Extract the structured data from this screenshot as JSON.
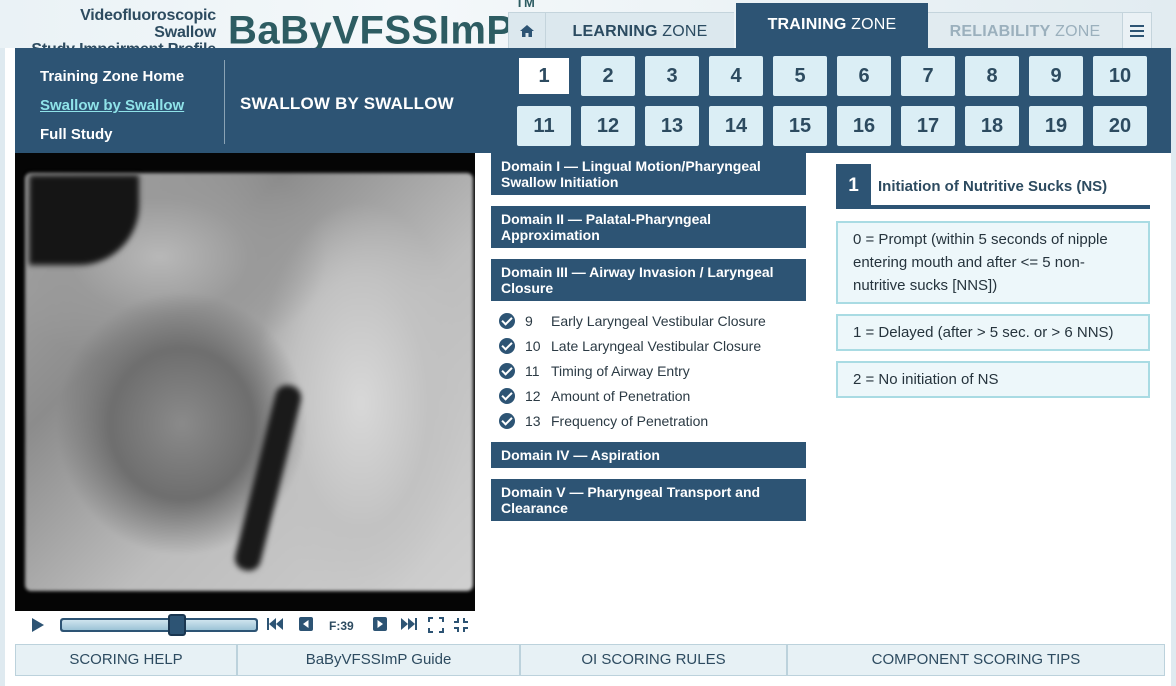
{
  "header": {
    "subtitle_line1": "Videofluoroscopic Swallow",
    "subtitle_line2": "Study Impairment Profile",
    "logo": "BaByVFSSImP",
    "logo_tm": "TM"
  },
  "zones": {
    "learning_bold": "LEARNING",
    "learning_rest": " ZONE",
    "training_bold": "TRAINING",
    "training_rest": " ZONE",
    "reliability_bold": "RELIABILITY",
    "reliability_rest": " ZONE"
  },
  "nav": {
    "links": [
      "Training Zone Home",
      "Swallow by Swallow",
      "Full Study"
    ],
    "active_index": 1,
    "section_title": "SWALLOW BY SWALLOW"
  },
  "swallows": {
    "numbers": [
      "1",
      "2",
      "3",
      "4",
      "5",
      "6",
      "7",
      "8",
      "9",
      "10",
      "11",
      "12",
      "13",
      "14",
      "15",
      "16",
      "17",
      "18",
      "19",
      "20"
    ],
    "active": "1"
  },
  "player": {
    "frame_label": "F:39",
    "progress": 0.6
  },
  "domains": [
    {
      "title": "Domain I — Lingual Motion/Pharyngeal Swallow Initiation",
      "items": []
    },
    {
      "title": "Domain II — Palatal-Pharyngeal Approximation",
      "items": []
    },
    {
      "title": "Domain III — Airway Invasion / Laryngeal Closure",
      "items": [
        {
          "num": "9",
          "label": "Early Laryngeal Vestibular Closure"
        },
        {
          "num": "10",
          "label": "Late Laryngeal Vestibular Closure"
        },
        {
          "num": "11",
          "label": "Timing of Airway Entry"
        },
        {
          "num": "12",
          "label": "Amount of Penetration"
        },
        {
          "num": "13",
          "label": "Frequency of Penetration"
        }
      ]
    },
    {
      "title": "Domain IV — Aspiration",
      "items": []
    },
    {
      "title": "Domain V — Pharyngeal Transport and Clearance",
      "items": []
    }
  ],
  "component": {
    "number": "1",
    "title": "Initiation of Nutritive Sucks (NS)",
    "options": [
      "0 = Prompt (within 5 seconds of nipple entering mouth and after <= 5 non-nutritive sucks [NNS])",
      "1 = Delayed (after > 5 sec. or > 6 NNS)",
      "2 = No initiation of NS"
    ]
  },
  "footer": {
    "buttons": [
      "SCORING HELP",
      "BaByVFSSImP Guide",
      "OI SCORING RULES",
      "COMPONENT SCORING TIPS"
    ]
  },
  "colors": {
    "primary": "#2d5474",
    "accent_link": "#8fe3e9",
    "swallow_button": "#dbeef5",
    "option_border": "#a9dbe3"
  }
}
